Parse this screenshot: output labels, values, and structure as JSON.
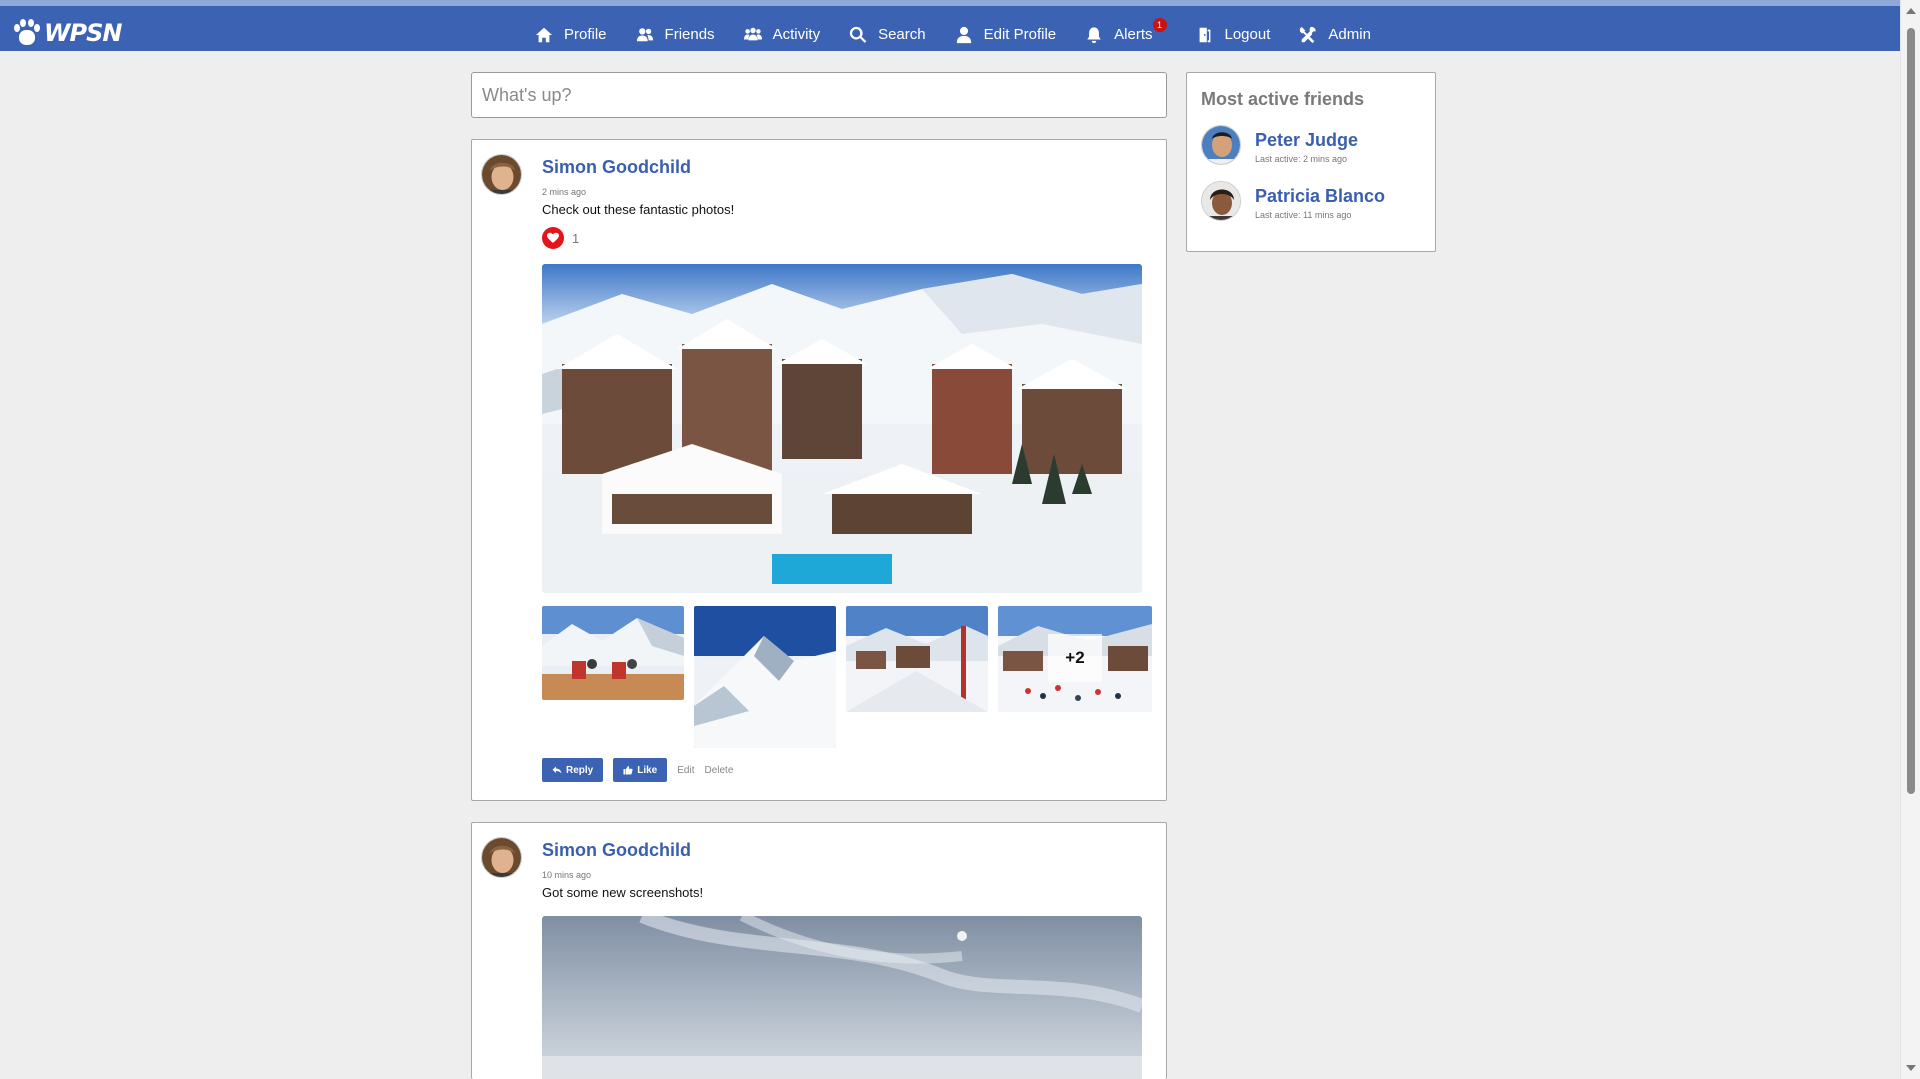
{
  "app": {
    "logo_text": "WPSN"
  },
  "nav": [
    {
      "label": "Profile",
      "icon": "home-icon"
    },
    {
      "label": "Friends",
      "icon": "friends-icon"
    },
    {
      "label": "Activity",
      "icon": "activity-icon"
    },
    {
      "label": "Search",
      "icon": "search-icon"
    },
    {
      "label": "Edit Profile",
      "icon": "user-icon"
    },
    {
      "label": "Alerts",
      "icon": "bell-icon",
      "badge": "1"
    },
    {
      "label": "Logout",
      "icon": "logout-icon"
    },
    {
      "label": "Admin",
      "icon": "tools-icon"
    }
  ],
  "composer": {
    "placeholder": "What's up?"
  },
  "posts": [
    {
      "author": "Simon Goodchild",
      "time": "2 mins ago",
      "text": "Check out these fantastic photos!",
      "reaction_count": "1",
      "more_photos": "+2",
      "actions": {
        "reply": "Reply",
        "like": "Like",
        "edit": "Edit",
        "delete": "Delete"
      }
    },
    {
      "author": "Simon Goodchild",
      "time": "10 mins ago",
      "text": "Got some new screenshots!"
    }
  ],
  "sidebar": {
    "title": "Most active friends",
    "friends": [
      {
        "name": "Peter Judge",
        "last_active": "Last active: 2 mins ago"
      },
      {
        "name": "Patricia Blanco",
        "last_active": "Last active: 11 mins ago"
      }
    ]
  },
  "colors": {
    "brand": "#3b62b3",
    "link": "#3a5fae",
    "heart": "#e4141a",
    "background": "#eeeeee"
  }
}
